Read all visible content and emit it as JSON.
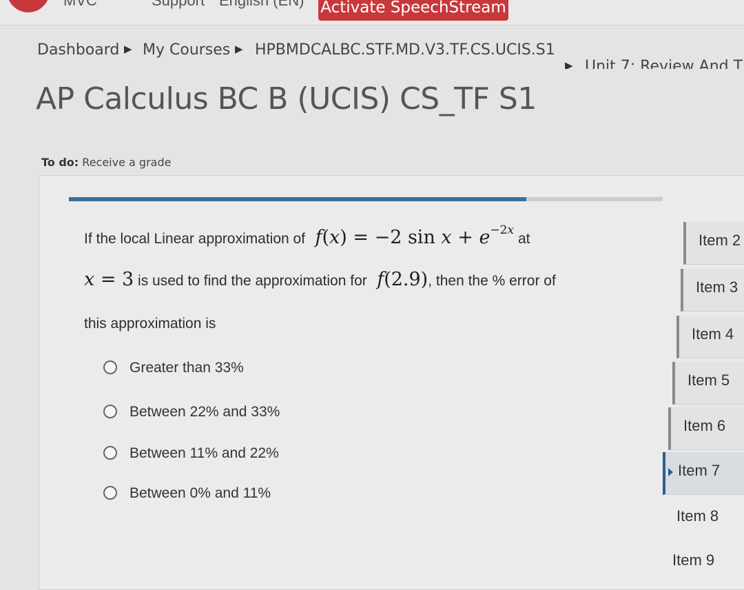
{
  "topbar": {
    "activate_label": "Activate SpeechStream",
    "cut_left": "MVC",
    "cut_mid": "Support",
    "cut_right": "English (EN)"
  },
  "breadcrumb": {
    "items": [
      "Dashboard",
      "My Courses",
      "HPBMDCALBC.STF.MD.V3.TF.CS.UCIS.S1",
      "Unit 7: Review And T"
    ]
  },
  "page_title": "AP Calculus BC B (UCIS) CS_TF S1",
  "todo": {
    "label": "To do:",
    "value": "Receive a grade"
  },
  "progress": {
    "fraction": 0.77
  },
  "question": {
    "line1_pre": "If the local Linear approximation of",
    "line1_post": "at",
    "line2_post": "is used to find the approximation for",
    "line2_tail": ", then the % error of",
    "line3": "this approximation is"
  },
  "options": [
    "Greater than 33%",
    "Between 22% and 33%",
    "Between 11% and 22%",
    "Between 0% and 11%"
  ],
  "side_nav": {
    "items": [
      "Item 2",
      "Item 3",
      "Item 4",
      "Item 5",
      "Item 6",
      "Item 7",
      "Item 8",
      "Item 9"
    ],
    "active": "Item 7"
  }
}
